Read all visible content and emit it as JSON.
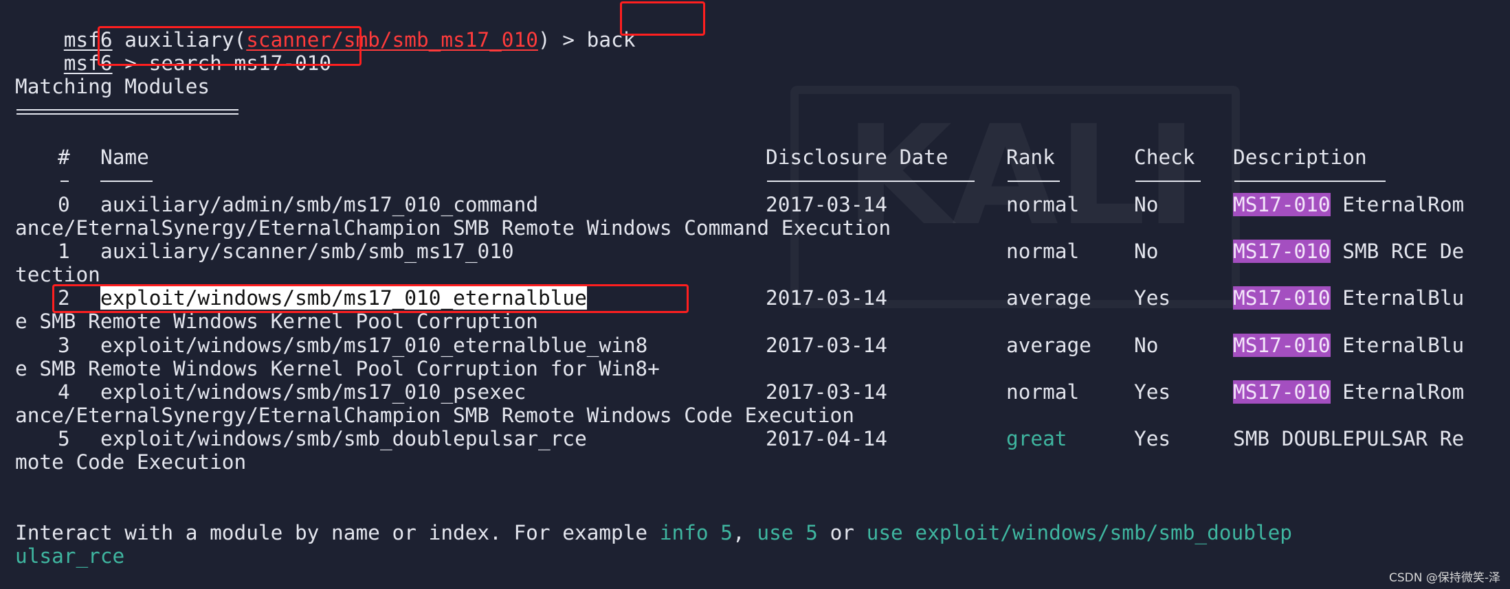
{
  "terminal": {
    "prompt": "msf6",
    "cmd1_pre": " auxiliary(",
    "cmd1_module": "scanner/smb/smb_ms17_010",
    "cmd1_post": ") > ",
    "cmd1_input": "back",
    "cmd2_post": " > ",
    "cmd2_input": "search ms17-010",
    "heading": "Matching Modules",
    "headers": {
      "index": "#",
      "name": "Name",
      "date": "Disclosure Date",
      "rank": "Rank",
      "check": "Check",
      "description": "Description"
    },
    "rows": [
      {
        "index": "0",
        "name": "auxiliary/admin/smb/ms17_010_command",
        "date": "2017-03-14",
        "rank": "normal",
        "check": "No",
        "tag": "MS17-010",
        "desc": " EternalRom",
        "wrap": "ance/EternalSynergy/EternalChampion SMB Remote Windows Command Execution"
      },
      {
        "index": "1",
        "name": "auxiliary/scanner/smb/smb_ms17_010",
        "date": "",
        "rank": "normal",
        "check": "No",
        "tag": "MS17-010",
        "desc": " SMB RCE De",
        "wrap": "tection"
      },
      {
        "index": "2",
        "name": "exploit/windows/smb/ms17_010_eternalblue",
        "date": "2017-03-14",
        "rank": "average",
        "check": "Yes",
        "tag": "MS17-010",
        "desc": " EternalBlu",
        "wrap": "e SMB Remote Windows Kernel Pool Corruption"
      },
      {
        "index": "3",
        "name": "exploit/windows/smb/ms17_010_eternalblue_win8",
        "date": "2017-03-14",
        "rank": "average",
        "check": "No",
        "tag": "MS17-010",
        "desc": " EternalBlu",
        "wrap": "e SMB Remote Windows Kernel Pool Corruption for Win8+"
      },
      {
        "index": "4",
        "name": "exploit/windows/smb/ms17_010_psexec",
        "date": "2017-03-14",
        "rank": "normal",
        "check": "Yes",
        "tag": "MS17-010",
        "desc": " EternalRom",
        "wrap": "ance/EternalSynergy/EternalChampion SMB Remote Windows Code Execution"
      },
      {
        "index": "5",
        "name": "exploit/windows/smb/smb_doublepulsar_rce",
        "date": "2017-04-14",
        "rank": "great",
        "check": "Yes",
        "tag": "",
        "desc": "SMB DOUBLEPULSAR Re",
        "wrap": "mote Code Execution"
      }
    ],
    "footer": {
      "pre": "Interact with a module by name or index. For example ",
      "info": "info 5",
      "sep1": ", ",
      "use": "use 5",
      "sep2": " or ",
      "use_full": "use exploit/windows/smb/smb_doublep",
      "wrap": "ulsar_rce"
    }
  },
  "watermark": "CSDN @保持微笑-泽",
  "colors": {
    "background": "#1d2131",
    "text": "#e4e6ee",
    "module_red": "#ff3b3b",
    "highlight_purple": "#a44fc0",
    "great_green": "#3fb6a0",
    "annotation_red": "#ff1f1f"
  }
}
